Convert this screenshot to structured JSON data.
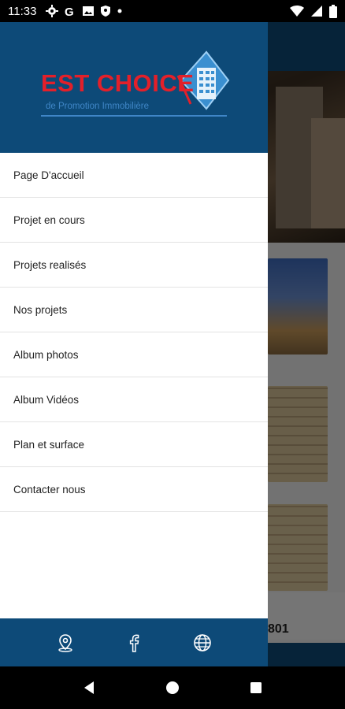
{
  "status_bar": {
    "time": "11:33",
    "icons": [
      "settings-icon",
      "google-icon",
      "image-icon",
      "shield-icon",
      "dot-icon"
    ],
    "right_icons": [
      "wifi-icon",
      "signal-icon",
      "battery-icon"
    ]
  },
  "background": {
    "visible_number": "801"
  },
  "drawer": {
    "logo": {
      "title": "EST CHOICE",
      "subtitle": "de Promotion Immobilière"
    },
    "menu": [
      {
        "label": "Page D'accueil"
      },
      {
        "label": "Projet en cours"
      },
      {
        "label": "Projets realisés"
      },
      {
        "label": "Nos projets"
      },
      {
        "label": "Album photos"
      },
      {
        "label": "Album Vidéos"
      },
      {
        "label": "Plan et surface"
      },
      {
        "label": "Contacter nous"
      }
    ],
    "footer_icons": [
      "location-pin-icon",
      "facebook-icon",
      "globe-icon"
    ]
  },
  "navbar": {
    "icons": [
      "back-icon",
      "home-icon",
      "recents-icon"
    ]
  },
  "colors": {
    "brand_blue": "#0d4a78",
    "logo_red": "#e3202a",
    "logo_light_blue": "#3f86c7"
  }
}
